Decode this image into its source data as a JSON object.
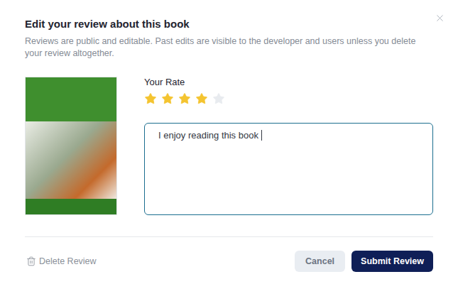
{
  "dialog": {
    "title": "Edit your review about this book",
    "subtitle": "Reviews are public and editable. Past edits are visible to the developer and users unless you delete your review altogether."
  },
  "rating": {
    "label": "Your Rate",
    "stars": 4,
    "max": 5
  },
  "review": {
    "value": "I enjoy reading this book",
    "focused": true
  },
  "buttons": {
    "delete": "Delete Review",
    "cancel": "Cancel",
    "submit": "Submit Review"
  }
}
